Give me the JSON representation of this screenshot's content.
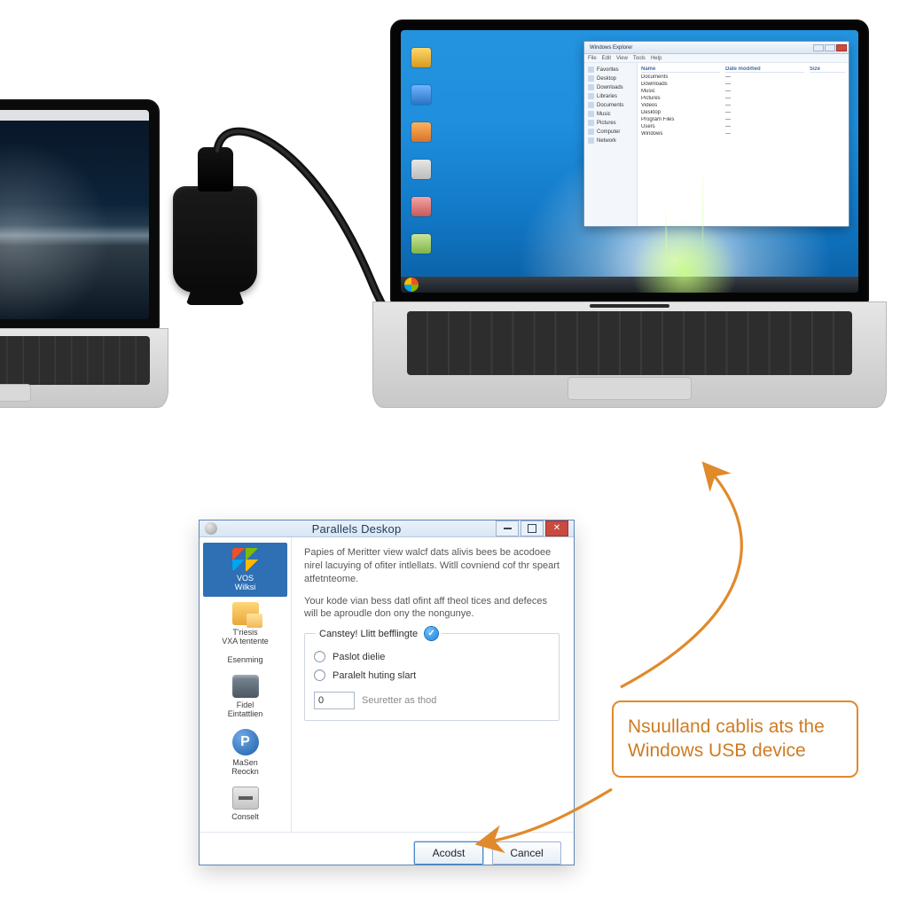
{
  "right_screen": {
    "explorer": {
      "title": "Windows Explorer",
      "menus": [
        "File",
        "Edit",
        "View",
        "Tools",
        "Help"
      ],
      "side_items": [
        "Favorites",
        "Desktop",
        "Downloads",
        "Libraries",
        "Documents",
        "Music",
        "Pictures",
        "Computer",
        "Network"
      ],
      "columns": [
        "Name",
        "Date modified",
        "Size"
      ],
      "rows": [
        [
          "Documents",
          "—",
          ""
        ],
        [
          "Downloads",
          "—",
          ""
        ],
        [
          "Music",
          "—",
          ""
        ],
        [
          "Pictures",
          "—",
          ""
        ],
        [
          "Videos",
          "—",
          ""
        ],
        [
          "Desktop",
          "—",
          ""
        ],
        [
          "Program Files",
          "—",
          ""
        ],
        [
          "Users",
          "—",
          ""
        ],
        [
          "Windows",
          "—",
          ""
        ]
      ]
    }
  },
  "dialog": {
    "title": "Parallels Deskop",
    "paragraph1": "Papies of Meritter view walcf dats alivis bees be acodoee nirel lacuying of ofiter intlellats. Witll covniend cof thr speart atfetnteome.",
    "paragraph2": "Your kode vian bess datl ofint aff theol tices and defeces will be aproudle don ony the nongunye.",
    "fieldset_label": "Canstey! Llitt befflingte",
    "radio1": "Paslot dielie",
    "radio2": "Paralelt huting slart",
    "number_value": "0",
    "number_hint": "Seuretter as thod",
    "accept": "Acodst",
    "cancel": "Cancel",
    "sidebar": [
      {
        "label_line1": "VOS",
        "label_line2": "Wilksi"
      },
      {
        "label_line1": "T'riesis",
        "label_line2": "VXA tentente"
      },
      {
        "label_line1": "Esenming",
        "label_line2": ""
      },
      {
        "label_line1": "Fidel",
        "label_line2": "Eintattlien"
      },
      {
        "label_line1": "MaSen",
        "label_line2": "Reockn"
      },
      {
        "label_line1": "Conselt",
        "label_line2": ""
      }
    ]
  },
  "callout": {
    "line1": "Nsuulland cablis ats the",
    "line2": "Windows USB device"
  }
}
